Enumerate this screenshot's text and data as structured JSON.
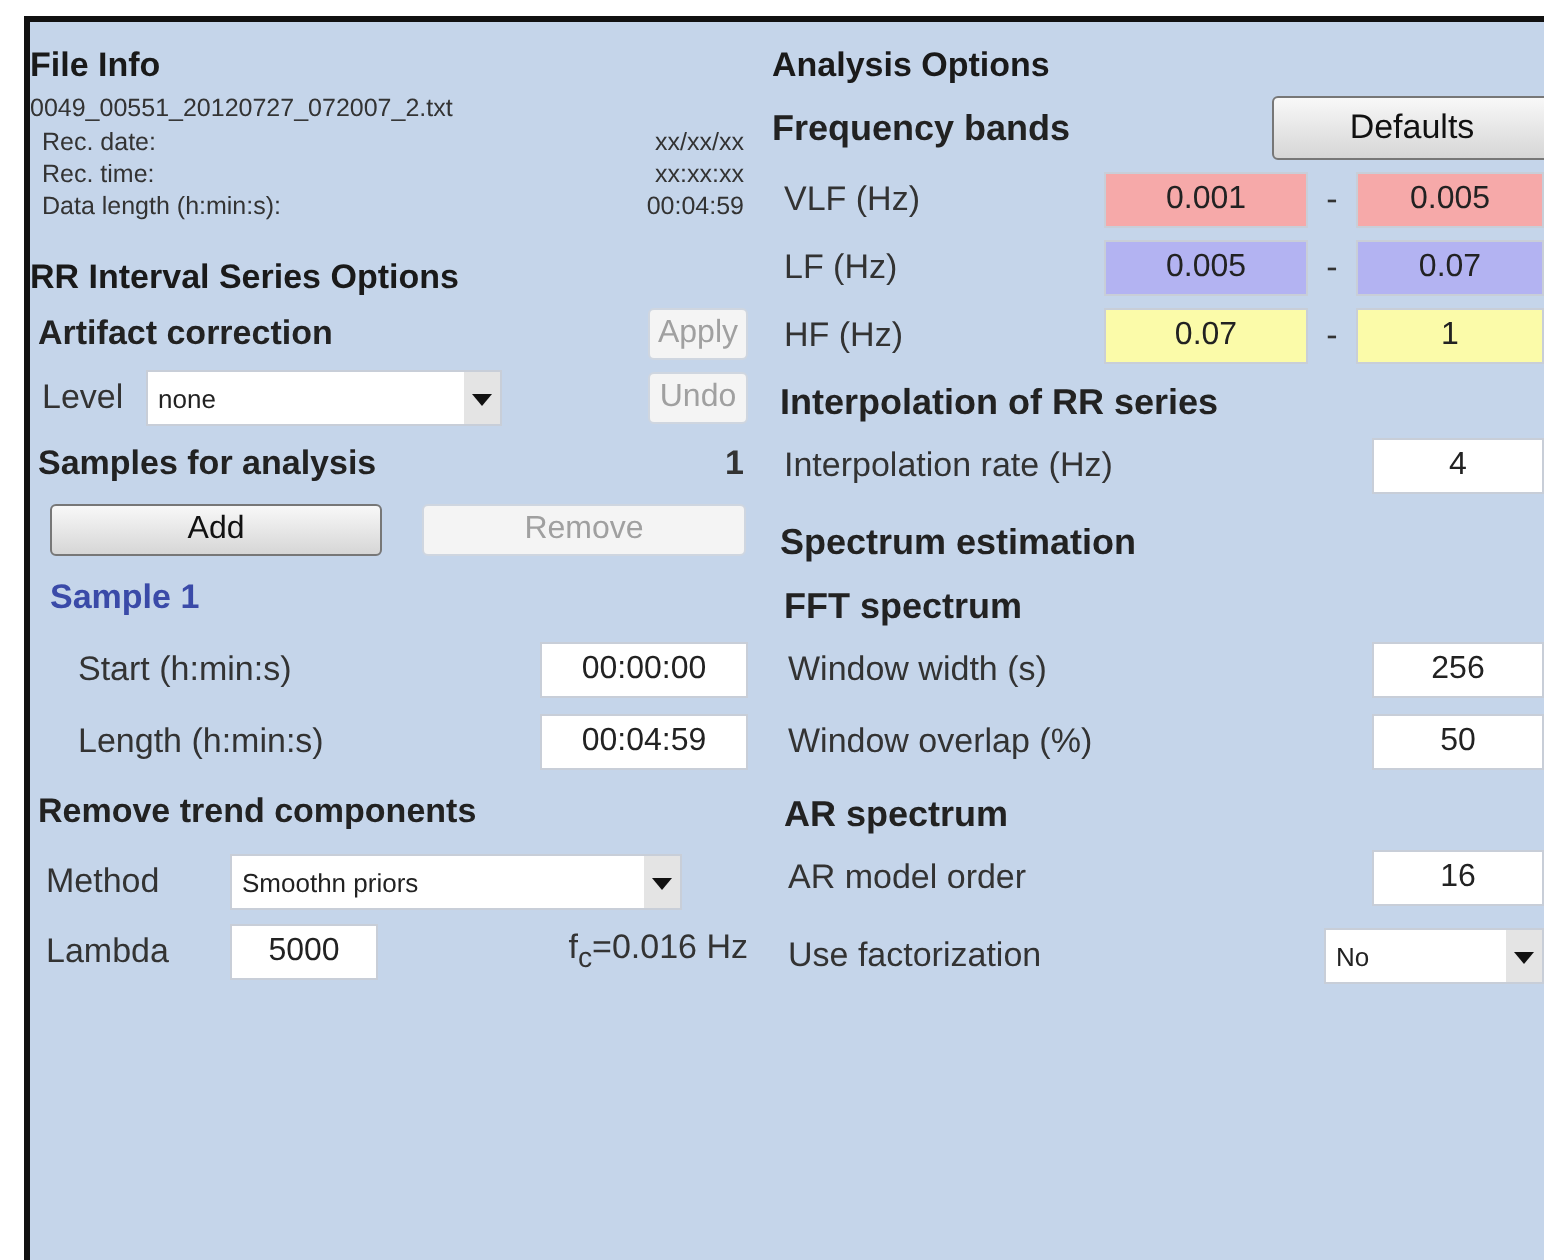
{
  "file_info": {
    "title": "File Info",
    "file_name": "0049_00551_20120727_072007_2.txt",
    "rows": [
      {
        "label": "Rec. date:",
        "value": "xx/xx/xx"
      },
      {
        "label": "Rec. time:",
        "value": "xx:xx:xx"
      },
      {
        "label": "Data length (h:min:s):",
        "value": "00:04:59"
      }
    ]
  },
  "rr_options": {
    "title": "RR Interval Series Options",
    "artifact": {
      "title": "Artifact correction",
      "apply": {
        "label": "Apply",
        "disabled": true
      },
      "level_label": "Level",
      "level_value": "none",
      "undo": {
        "label": "Undo",
        "disabled": true
      }
    },
    "samples": {
      "title": "Samples for analysis",
      "count": "1",
      "add": {
        "label": "Add",
        "disabled": false
      },
      "remove": {
        "label": "Remove",
        "disabled": true
      },
      "sample_title": "Sample 1",
      "fields": [
        {
          "label": "Start (h:min:s)",
          "value": "00:00:00"
        },
        {
          "label": "Length (h:min:s)",
          "value": "00:04:59"
        }
      ]
    },
    "trend": {
      "title": "Remove trend components",
      "method_label": "Method",
      "method_value": "Smoothn priors",
      "lambda_label": "Lambda",
      "lambda_value": "5000",
      "cutoff": "f$_{c}$=0.016 Hz"
    }
  },
  "analysis": {
    "title": "Analysis Options",
    "bands_title": "Frequency bands",
    "defaults": {
      "label": "Defaults",
      "disabled": false
    },
    "bands": [
      {
        "label": "VLF (Hz)",
        "low": "0.001",
        "high": "0.005",
        "color": "#f6a9a9"
      },
      {
        "label": "LF (Hz)",
        "low": "0.005",
        "high": "0.07",
        "color": "#b3b3f2"
      },
      {
        "label": "HF (Hz)",
        "low": "0.07",
        "high": "1",
        "color": "#fbfba9"
      }
    ],
    "separator": "-",
    "interp_title": "Interpolation of RR series",
    "interp_label": "Interpolation rate (Hz)",
    "interp_value": "4",
    "spectrum_title": "Spectrum estimation",
    "fft_title": "FFT spectrum",
    "fft_fields": [
      {
        "label": "Window width (s)",
        "value": "256"
      },
      {
        "label": "Window overlap (%)",
        "value": "50"
      }
    ],
    "ar_title": "AR spectrum",
    "ar_label": "AR model order",
    "ar_value": "16",
    "factor_label": "Use factorization",
    "factor_value": "No"
  }
}
